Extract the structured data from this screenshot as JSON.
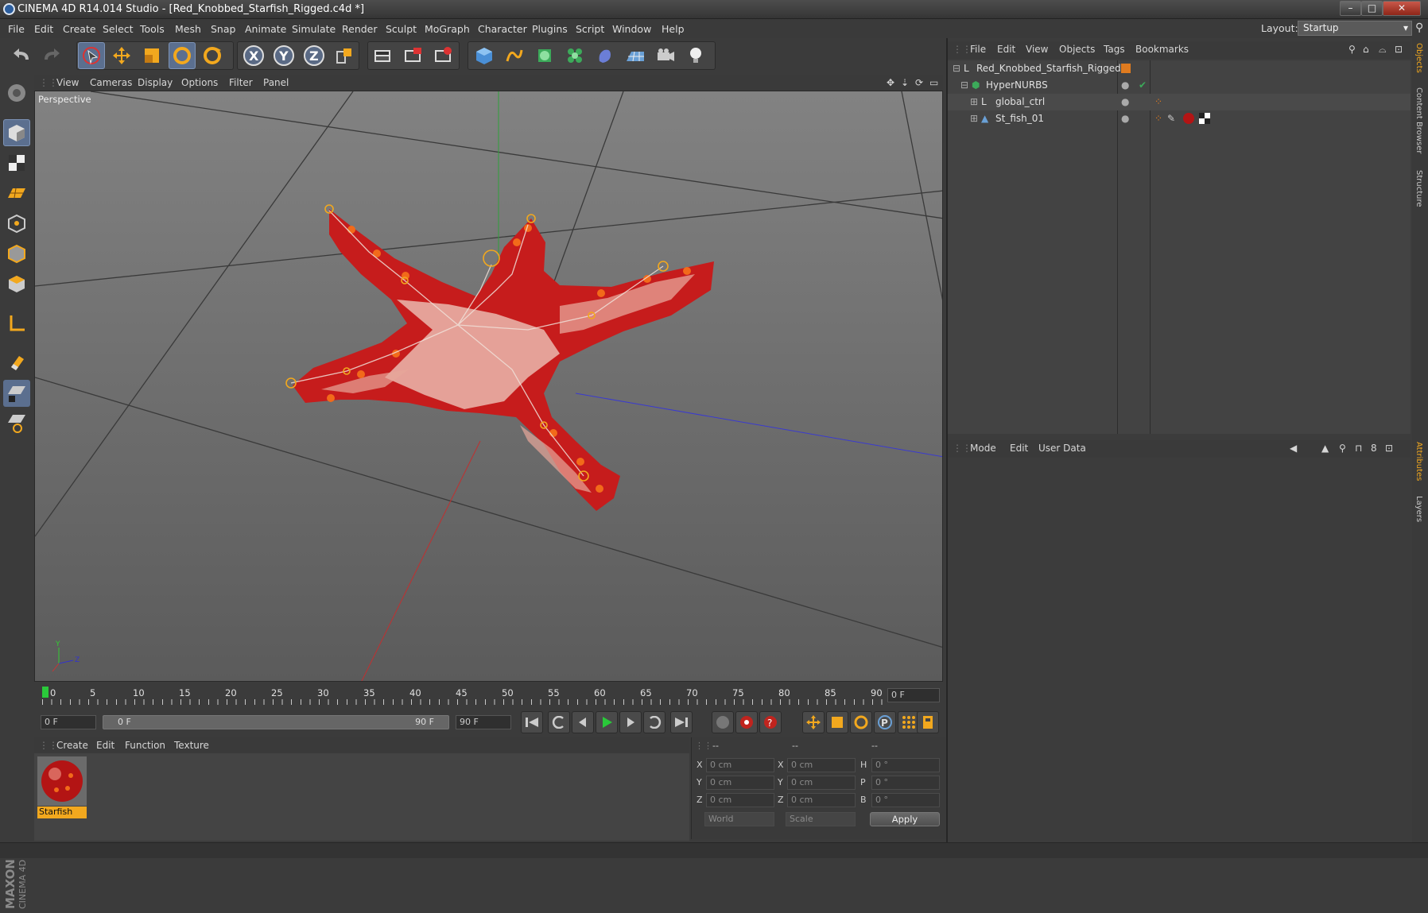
{
  "window": {
    "title": "CINEMA 4D R14.014 Studio - [Red_Knobbed_Starfish_Rigged.c4d *]",
    "min": "–",
    "max": "□",
    "close": "✕"
  },
  "menubar": {
    "items": [
      "File",
      "Edit",
      "Create",
      "Select",
      "Tools",
      "Mesh",
      "Snap",
      "Animate",
      "Simulate",
      "Render",
      "Sculpt",
      "MoGraph",
      "Character",
      "Plugins",
      "Script",
      "Window",
      "Help"
    ],
    "layout_label": "Layout:",
    "layout_value": "Startup"
  },
  "viewport": {
    "menu": [
      "View",
      "Cameras",
      "Display",
      "Options",
      "Filter",
      "Panel"
    ],
    "label": "Perspective"
  },
  "timeline": {
    "ticks": [
      "0",
      "5",
      "10",
      "15",
      "20",
      "25",
      "30",
      "35",
      "40",
      "45",
      "50",
      "55",
      "60",
      "65",
      "70",
      "75",
      "80",
      "85",
      "90"
    ],
    "current_frame": "0 F",
    "start_frame": "0 F",
    "range_start": "0 F",
    "range_end": "90 F",
    "end_frame": "90 F"
  },
  "materials": {
    "menu": [
      "Create",
      "Edit",
      "Function",
      "Texture"
    ],
    "items": [
      {
        "name": "Starfish"
      }
    ]
  },
  "coordinates": {
    "headers": [
      "--",
      "--",
      "--"
    ],
    "rows": [
      {
        "axis": "X",
        "pos": "0 cm",
        "size_axis": "X",
        "size": "0 cm",
        "rot_axis": "H",
        "rot": "0 °"
      },
      {
        "axis": "Y",
        "pos": "0 cm",
        "size_axis": "Y",
        "size": "0 cm",
        "rot_axis": "P",
        "rot": "0 °"
      },
      {
        "axis": "Z",
        "pos": "0 cm",
        "size_axis": "Z",
        "size": "0 cm",
        "rot_axis": "B",
        "rot": "0 °"
      }
    ],
    "mode": "World",
    "scale": "Scale",
    "apply": "Apply"
  },
  "objects": {
    "menu": [
      "File",
      "Edit",
      "View",
      "Objects",
      "Tags",
      "Bookmarks"
    ],
    "tree": [
      {
        "name": "Red_Knobbed_Starfish_Rigged",
        "icon": "null-object-icon"
      },
      {
        "name": "HyperNURBS",
        "icon": "hypernurbs-icon"
      },
      {
        "name": "global_ctrl",
        "icon": "null-object-icon"
      },
      {
        "name": "St_fish_01",
        "icon": "polygon-object-icon"
      }
    ]
  },
  "attributes": {
    "menu": [
      "Mode",
      "Edit",
      "User Data"
    ]
  },
  "side_tabs": [
    "Objects",
    "Content Browser",
    "Structure",
    "Attributes",
    "Layers"
  ],
  "branding": {
    "line1": "MAXON",
    "line2": "CINEMA 4D"
  },
  "colors": {
    "accent": "#e07b1f",
    "selection": "#5b6f8f",
    "starfish_red": "#c41a1a",
    "axis_x": "#c03030",
    "axis_y": "#30b030",
    "axis_z": "#3030c0"
  }
}
